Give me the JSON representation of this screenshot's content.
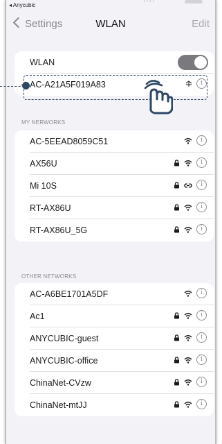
{
  "status": {
    "back_app": "◂ Anycubic",
    "dots": "····"
  },
  "nav": {
    "back_label": "Settings",
    "title": "WLAN",
    "edit_label": "Edit"
  },
  "wlan_group": {
    "label": "WLAN",
    "toggle_on": true,
    "connected_network": "AC-A21A5F019A83",
    "checkmark": "✓",
    "info_glyph": "i"
  },
  "my_networks": {
    "header": "MY NERWORKS",
    "items": [
      {
        "name": "AC-5EEAD8059C51",
        "lock": false,
        "signal": "wifi"
      },
      {
        "name": "AX56U",
        "lock": true,
        "signal": "wifi"
      },
      {
        "name": "Mi 10S",
        "lock": true,
        "signal": "hotspot"
      },
      {
        "name": "RT-AX86U",
        "lock": true,
        "signal": "wifi"
      },
      {
        "name": "RT-AX86U_5G",
        "lock": true,
        "signal": "wifi"
      }
    ]
  },
  "other_networks": {
    "header": "OTHER NETWORKS",
    "items": [
      {
        "name": "AC-A6BE1701A5DF",
        "lock": false,
        "signal": "wifi"
      },
      {
        "name": "Ac1",
        "lock": true,
        "signal": "wifi"
      },
      {
        "name": "ANYCUBIC-guest",
        "lock": true,
        "signal": "wifi"
      },
      {
        "name": "ANYCUBIC-office",
        "lock": true,
        "signal": "wifi"
      },
      {
        "name": "ChinaNet-CVzw",
        "lock": true,
        "signal": "wifi"
      },
      {
        "name": "ChinaNet-mtJJ",
        "lock": true,
        "signal": "wifi"
      }
    ]
  },
  "colors": {
    "accent": "#2e4766",
    "toggle": "#7a7a7e",
    "background": "#f2f2f7"
  }
}
